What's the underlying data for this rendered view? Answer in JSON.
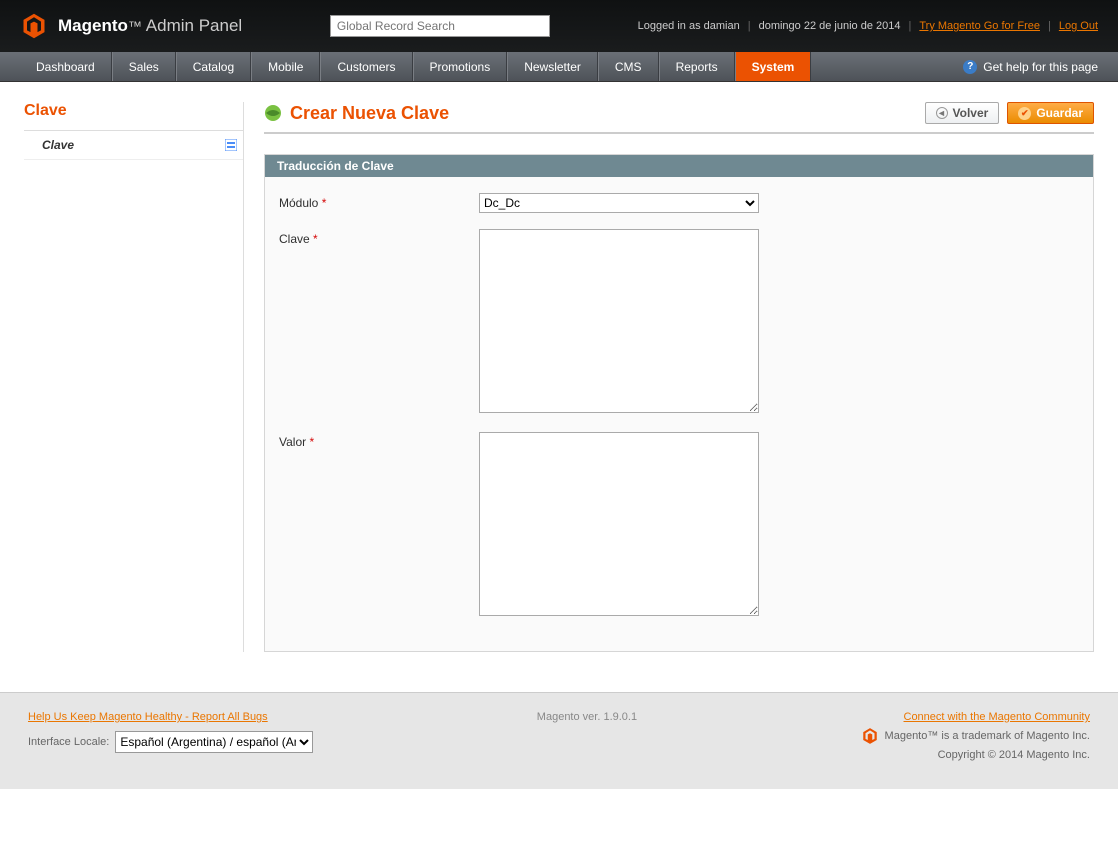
{
  "header": {
    "brand": "Magento",
    "admin_suffix": "Admin Panel",
    "search_placeholder": "Global Record Search",
    "logged_in": "Logged in as damian",
    "date": "domingo 22 de junio de 2014",
    "try_link": "Try Magento Go for Free",
    "logout": "Log Out"
  },
  "nav": {
    "items": [
      "Dashboard",
      "Sales",
      "Catalog",
      "Mobile",
      "Customers",
      "Promotions",
      "Newsletter",
      "CMS",
      "Reports",
      "System"
    ],
    "active_index": 9,
    "help": "Get help for this page"
  },
  "sidebar": {
    "title": "Clave",
    "item": "Clave"
  },
  "page": {
    "title": "Crear Nueva Clave",
    "btn_back": "Volver",
    "btn_save": "Guardar",
    "fieldset_legend": "Traducción de Clave",
    "fields": {
      "modulo_label": "Módulo",
      "modulo_value": "Dc_Dc",
      "clave_label": "Clave",
      "clave_value": "",
      "valor_label": "Valor",
      "valor_value": ""
    }
  },
  "footer": {
    "bugs_link": "Help Us Keep Magento Healthy - Report All Bugs",
    "locale_label": "Interface Locale:",
    "locale_value": "Español (Argentina) / español (Ar",
    "version": "Magento ver. 1.9.0.1",
    "community": "Connect with the Magento Community",
    "trademark": "Magento™ is a trademark of Magento Inc.",
    "copyright": "Copyright © 2014 Magento Inc."
  }
}
